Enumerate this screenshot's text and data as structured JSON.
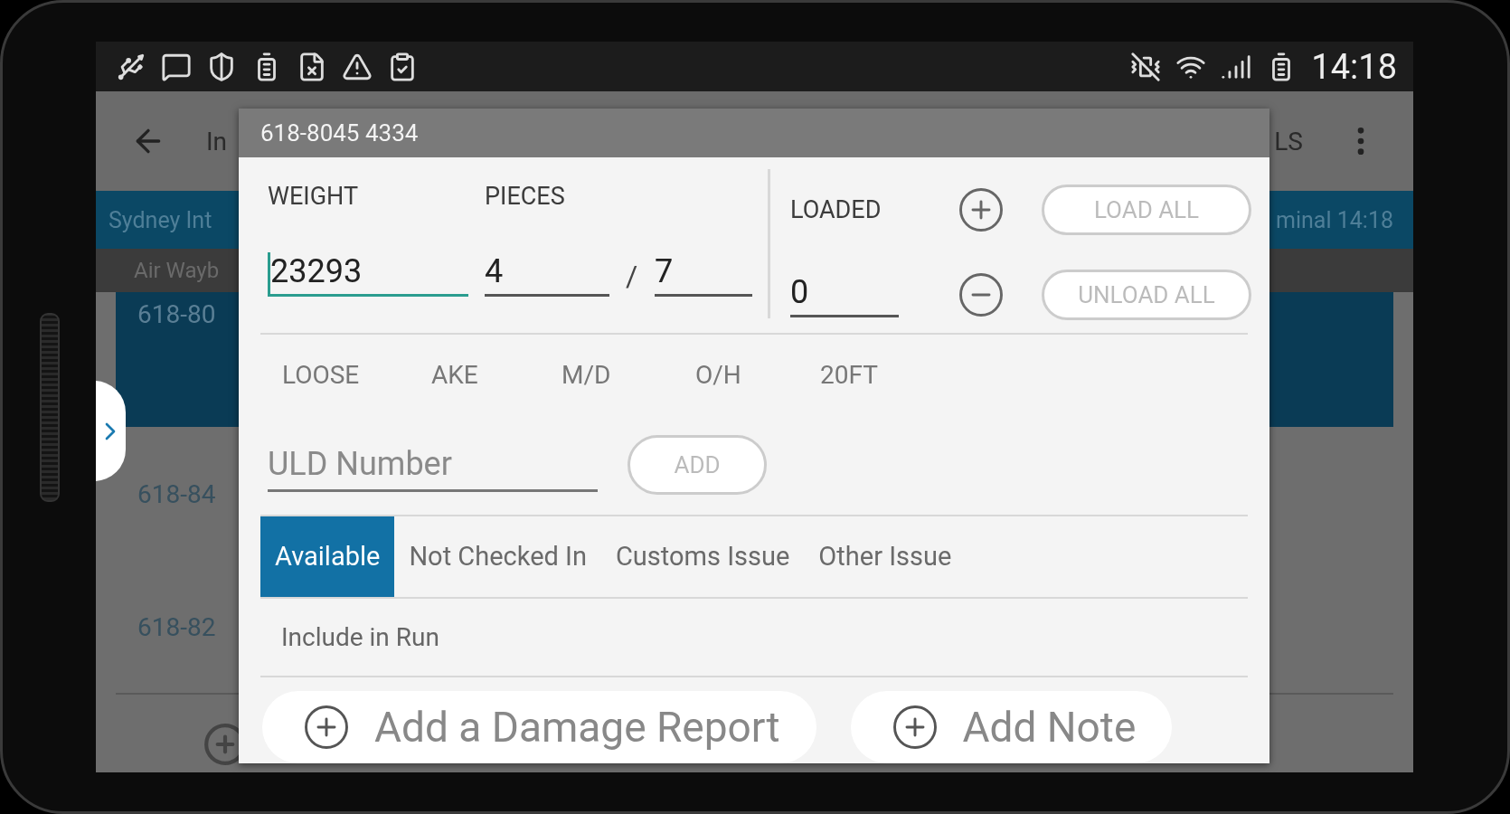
{
  "status_bar": {
    "time": "14:18"
  },
  "app_bar": {
    "title": "In",
    "action": "LS"
  },
  "banner": {
    "left": "Sydney Int",
    "right": "minal 14:18"
  },
  "list_header": {
    "label": "Air Wayb"
  },
  "list": [
    {
      "label": "618-80",
      "selected": true
    },
    {
      "label": "618-84",
      "selected": false
    },
    {
      "label": "618-82",
      "selected": false
    }
  ],
  "dialog": {
    "title": "618-8045 4334",
    "weight": {
      "label": "WEIGHT",
      "value": "23293",
      "focused": true
    },
    "pieces": {
      "label": "PIECES",
      "value": "4",
      "separator": "/",
      "total": "7"
    },
    "loaded": {
      "label": "LOADED",
      "value": "0"
    },
    "load_buttons": [
      {
        "kind": "plus",
        "label": "LOAD ALL"
      },
      {
        "kind": "minus",
        "label": "UNLOAD ALL"
      }
    ],
    "uld_types": [
      "LOOSE",
      "AKE",
      "M/D",
      "O/H",
      "20FT"
    ],
    "uld": {
      "placeholder": "ULD Number",
      "button": "ADD"
    },
    "status_tabs": [
      {
        "label": "Available",
        "selected": true
      },
      {
        "label": "Not Checked In",
        "selected": false
      },
      {
        "label": "Customs Issue",
        "selected": false
      },
      {
        "label": "Other Issue",
        "selected": false
      }
    ],
    "include": "Include in Run",
    "actions": [
      "Add a Damage Report",
      "Add Note"
    ]
  }
}
